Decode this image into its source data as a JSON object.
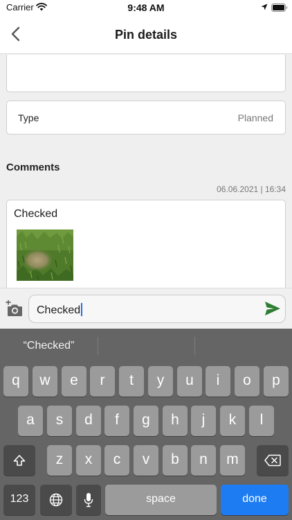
{
  "status_bar": {
    "carrier": "Carrier",
    "time": "9:48 AM"
  },
  "nav": {
    "title": "Pin details"
  },
  "details": {
    "type_label": "Type",
    "type_value": "Planned"
  },
  "comments": {
    "section_title": "Comments",
    "items": [
      {
        "timestamp": "06.06.2021 | 16:34",
        "text": "Checked",
        "has_photo": true
      }
    ]
  },
  "composer": {
    "text": "Checked"
  },
  "keyboard": {
    "suggestion": "“Checked”",
    "rows": [
      [
        "q",
        "w",
        "e",
        "r",
        "t",
        "y",
        "u",
        "i",
        "o",
        "p"
      ],
      [
        "a",
        "s",
        "d",
        "f",
        "g",
        "h",
        "j",
        "k",
        "l"
      ],
      [
        "z",
        "x",
        "c",
        "v",
        "b",
        "n",
        "m"
      ]
    ],
    "numbers_label": "123",
    "space_label": "space",
    "done_label": "done"
  },
  "colors": {
    "accent": "#1d7cf2",
    "send": "#2e7d32",
    "keyboard_bg": "#656565"
  }
}
